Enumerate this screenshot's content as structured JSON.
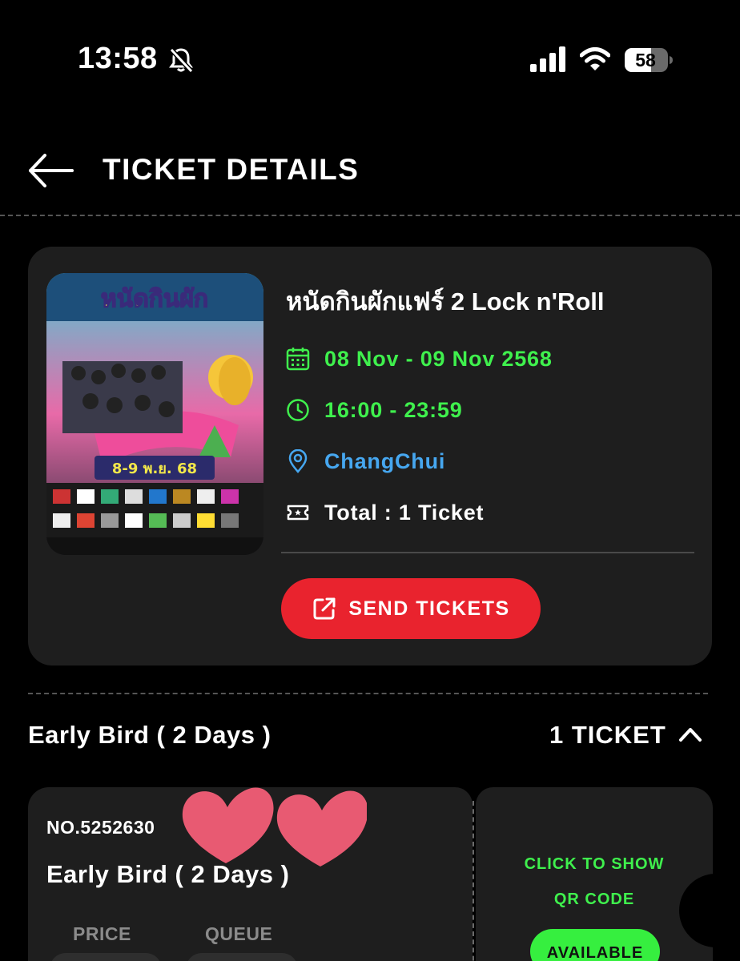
{
  "status_bar": {
    "time": "13:58",
    "battery": "58",
    "icons": [
      "bell-slash-icon",
      "cellular-signal-icon",
      "wifi-icon",
      "battery-icon"
    ]
  },
  "header": {
    "title": "TICKET DETAILS",
    "back_icon": "arrow-left-icon"
  },
  "event": {
    "title": "หนัดกินผักแฟร์ 2 Lock n'Roll",
    "date": "08 Nov - 09 Nov 2568",
    "time": "16:00 - 23:59",
    "location": "ChangChui",
    "total": "Total : 1 Ticket",
    "send_button": "SEND TICKETS"
  },
  "section": {
    "title": "Early Bird ( 2 Days )",
    "count": "1 TICKET"
  },
  "ticket": {
    "number": "NO.5252630",
    "type": "Early Bird ( 2 Days )",
    "price_label": "PRICE",
    "queue_label": "QUEUE",
    "qr_line1": "CLICK TO SHOW",
    "qr_line2": "QR CODE",
    "status": "AVAILABLE"
  },
  "colors": {
    "accent_green": "#3ff04d",
    "accent_blue": "#46a7f0",
    "send_red": "#e9232e",
    "card_bg": "#1e1e1e"
  }
}
